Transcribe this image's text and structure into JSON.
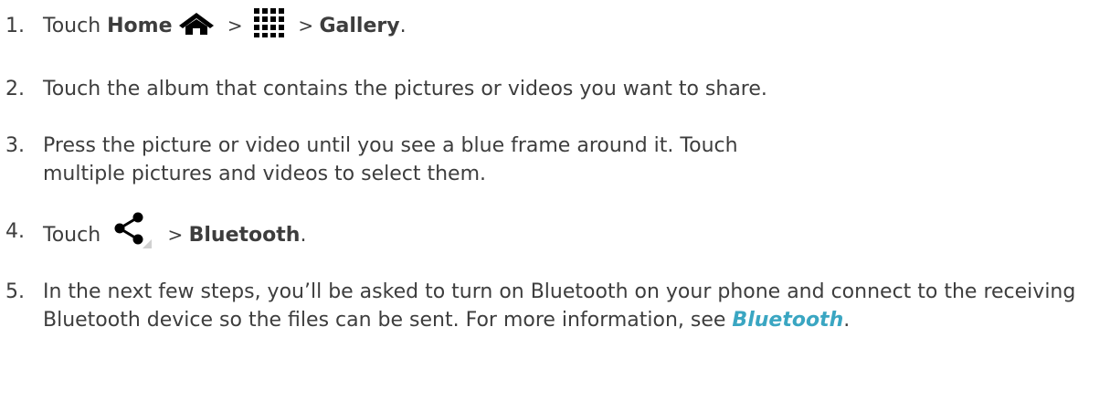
{
  "steps": [
    {
      "number": "1.",
      "prefix": "Touch ",
      "home": "Home",
      "sep1": " > ",
      "sep2": " > ",
      "gallery": "Gallery",
      "suffix": "."
    },
    {
      "number": "2.",
      "text": "Touch the album that contains the pictures or videos you want to share."
    },
    {
      "number": "3.",
      "text": "Press the picture or video until you see a blue frame around it. Touch multiple pictures and videos to select them."
    },
    {
      "number": "4.",
      "prefix": "Touch ",
      "sep": " > ",
      "bluetooth": "Bluetooth",
      "suffix": "."
    },
    {
      "number": "5.",
      "text": "In the next few steps, you’ll be asked to turn on Bluetooth on your phone and connect to the receiving Bluetooth device so the files can be sent. For more information, see ",
      "link": "Bluetooth",
      "suffix": "."
    }
  ],
  "icons": {
    "home": "home-icon",
    "apps": "apps-grid-icon",
    "share": "share-icon"
  },
  "colors": {
    "text": "#3d3d3d",
    "link": "#3aa6c2"
  }
}
